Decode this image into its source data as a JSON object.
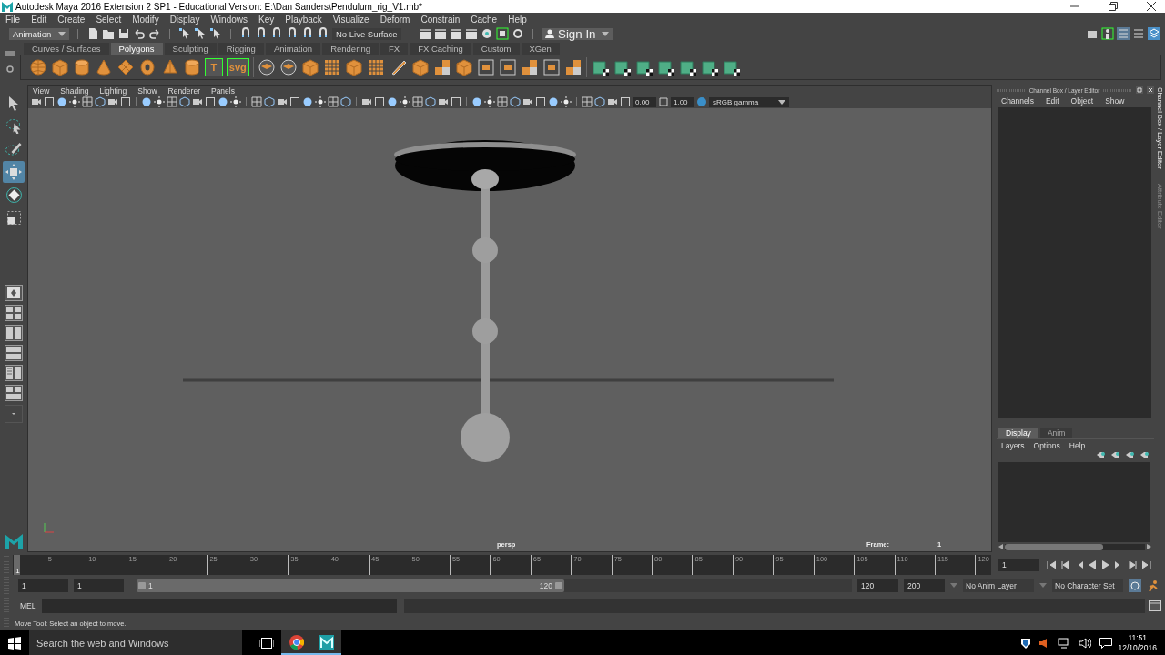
{
  "window": {
    "title": "Autodesk Maya 2016 Extension 2 SP1 - Educational Version: E:\\Dan Sanders\\Pendulum_rig_V1.mb*"
  },
  "menu_bar": [
    "File",
    "Edit",
    "Create",
    "Select",
    "Modify",
    "Display",
    "Windows",
    "Key",
    "Playback",
    "Visualize",
    "Deform",
    "Constrain",
    "Cache",
    "Help"
  ],
  "status_line": {
    "workspace": "Animation",
    "live_surface": "No Live Surface",
    "sign_in": "Sign In"
  },
  "shelf": {
    "tabs": [
      {
        "label": "Curves / Surfaces",
        "selected": false
      },
      {
        "label": "Polygons",
        "selected": true
      },
      {
        "label": "Sculpting",
        "selected": false
      },
      {
        "label": "Rigging",
        "selected": false
      },
      {
        "label": "Animation",
        "selected": false
      },
      {
        "label": "Rendering",
        "selected": false
      },
      {
        "label": "FX",
        "selected": false
      },
      {
        "label": "FX Caching",
        "selected": false
      },
      {
        "label": "Custom",
        "selected": false
      },
      {
        "label": "XGen",
        "selected": false
      }
    ],
    "tools": [
      {
        "kind": "sphere"
      },
      {
        "kind": "cube"
      },
      {
        "kind": "cylinder"
      },
      {
        "kind": "cone"
      },
      {
        "kind": "plane"
      },
      {
        "kind": "torus"
      },
      {
        "kind": "pyramid"
      },
      {
        "kind": "cylinder"
      },
      {
        "kind": "text",
        "text": "T"
      },
      {
        "kind": "text",
        "text": "svg"
      },
      {
        "kind": "separator"
      },
      {
        "kind": "disk"
      },
      {
        "kind": "disk"
      },
      {
        "kind": "cube"
      },
      {
        "kind": "grid"
      },
      {
        "kind": "cube"
      },
      {
        "kind": "grid"
      },
      {
        "kind": "knife"
      },
      {
        "kind": "cube"
      },
      {
        "kind": "tiles"
      },
      {
        "kind": "cube"
      },
      {
        "kind": "frame"
      },
      {
        "kind": "frame"
      },
      {
        "kind": "tiles"
      },
      {
        "kind": "frame"
      },
      {
        "kind": "tiles"
      },
      {
        "kind": "separator"
      },
      {
        "kind": "uv"
      },
      {
        "kind": "uv"
      },
      {
        "kind": "uv"
      },
      {
        "kind": "uv"
      },
      {
        "kind": "uv"
      },
      {
        "kind": "uv"
      },
      {
        "kind": "uv"
      }
    ]
  },
  "toolbox": [
    {
      "kind": "select",
      "selected": false
    },
    {
      "kind": "lasso",
      "selected": false
    },
    {
      "kind": "paint",
      "selected": false
    },
    {
      "kind": "move",
      "selected": true
    },
    {
      "kind": "rotate",
      "selected": false
    },
    {
      "kind": "scale",
      "selected": false
    }
  ],
  "viewport": {
    "menus": [
      "View",
      "Shading",
      "Lighting",
      "Show",
      "Renderer",
      "Panels"
    ],
    "exposure": "0.00",
    "gamma": "1.00",
    "color_space": "sRGB gamma",
    "camera": "persp",
    "frame_label": "Frame:",
    "frame": "1"
  },
  "channel_box": {
    "title": "Channel Box / Layer Editor",
    "menus": [
      "Channels",
      "Edit",
      "Object",
      "Show"
    ],
    "layer_tabs": [
      {
        "label": "Display",
        "selected": true
      },
      {
        "label": "Anim",
        "selected": false
      }
    ],
    "layer_menus": [
      "Layers",
      "Options",
      "Help"
    ]
  },
  "side_tabs": [
    {
      "label": "Channel Box / Layer Editor",
      "selected": true
    },
    {
      "label": "Attribute Editor",
      "selected": false
    }
  ],
  "time_slider": {
    "current_frame": "1",
    "ticks": [
      "5",
      "10",
      "15",
      "20",
      "25",
      "30",
      "35",
      "40",
      "45",
      "50",
      "55",
      "60",
      "65",
      "70",
      "75",
      "80",
      "85",
      "90",
      "95",
      "100",
      "105",
      "110",
      "115",
      "120"
    ],
    "frame_field": "1"
  },
  "range_slider": {
    "start": "1",
    "playback_start": "1",
    "range_start": "1",
    "range_end": "120",
    "playback_end": "120",
    "end": "200",
    "anim_layer": "No Anim Layer",
    "character_set": "No Character Set"
  },
  "command_line": {
    "label": "MEL"
  },
  "help_line": "Move Tool: Select an object to move.",
  "taskbar": {
    "search": "Search the web and Windows",
    "time": "11:51",
    "date": "12/10/2016"
  }
}
